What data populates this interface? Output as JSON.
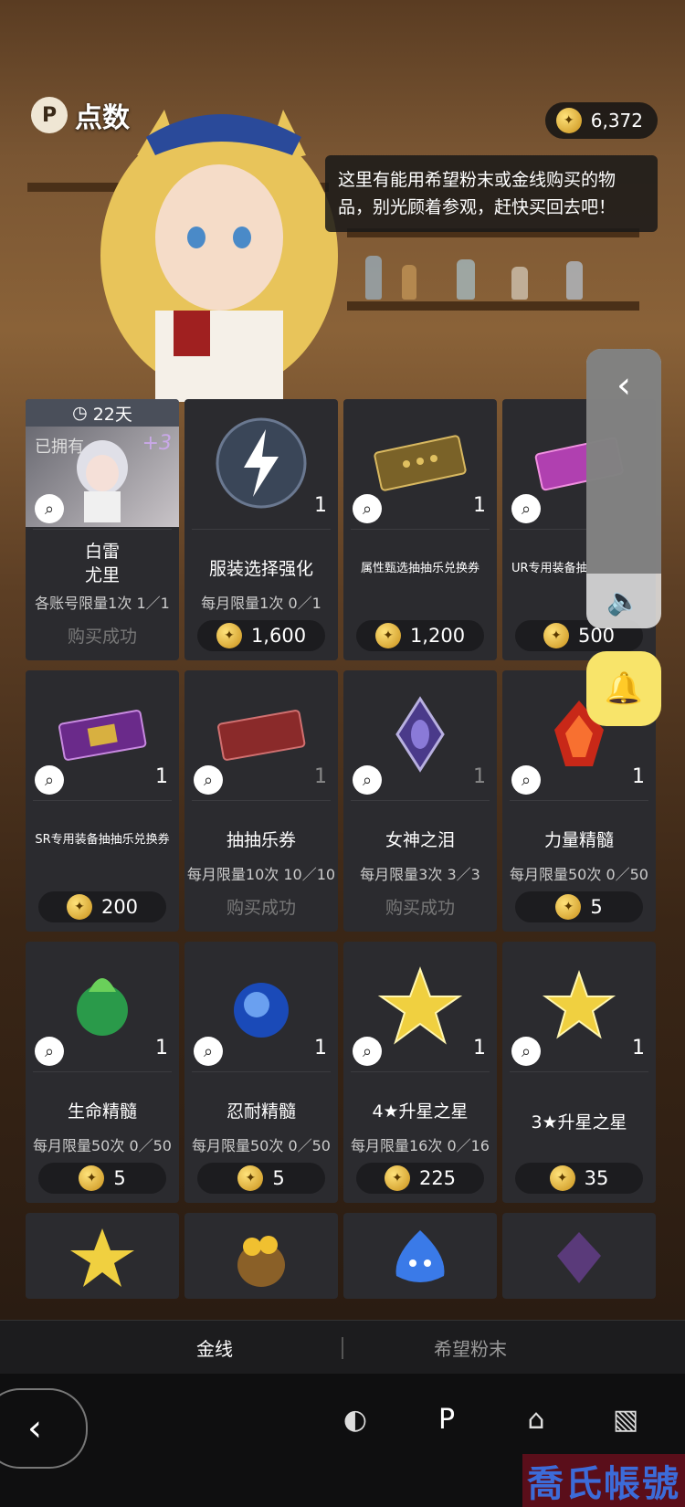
{
  "header": {
    "title": "点数",
    "currency_amount": "6,372"
  },
  "speech": {
    "text": "这里有能用希望粉末或金线购买的物品，别光顾着参观，赶快买回去吧！"
  },
  "cards": [
    {
      "timer": "22天",
      "owned": "已拥有",
      "plus": "+3",
      "name": "白雷\n尤里",
      "limit": "各账号限量1次 1／1",
      "sold": "购买成功",
      "qty": ""
    },
    {
      "name": "服装选择强化",
      "limit": "每月限量1次 0／1",
      "price": "1,600",
      "qty": "1"
    },
    {
      "name": "属性甄选抽抽乐兑换券",
      "price": "1,200",
      "qty": "1"
    },
    {
      "name": "UR专用装备抽",
      "price": "500",
      "qty": ""
    },
    {
      "name": "SR专用装备抽抽乐兑换券",
      "price": "200",
      "qty": "1"
    },
    {
      "name": "抽抽乐券",
      "limit": "每月限量10次 10／10",
      "sold": "购买成功",
      "qty": "1"
    },
    {
      "name": "女神之泪",
      "limit": "每月限量3次 3／3",
      "sold": "购买成功",
      "qty": "1"
    },
    {
      "name": "力量精髓",
      "limit": "每月限量50次 0／50",
      "price": "5",
      "qty": "1"
    },
    {
      "name": "生命精髓",
      "limit": "每月限量50次 0／50",
      "price": "5",
      "qty": "1"
    },
    {
      "name": "忍耐精髓",
      "limit": "每月限量50次 0／50",
      "price": "5",
      "qty": "1"
    },
    {
      "name": "4★升星之星",
      "limit": "每月限量16次 0／16",
      "price": "225",
      "qty": "1"
    },
    {
      "name": "3★升星之星",
      "price": "35",
      "qty": "1"
    }
  ],
  "tabs": {
    "gold": "金线",
    "hope": "希望粉末"
  },
  "watermark": "喬氏帳號",
  "colors": {
    "accent_bell": "#f8e46a",
    "card_bg": "#2b2b2f"
  }
}
